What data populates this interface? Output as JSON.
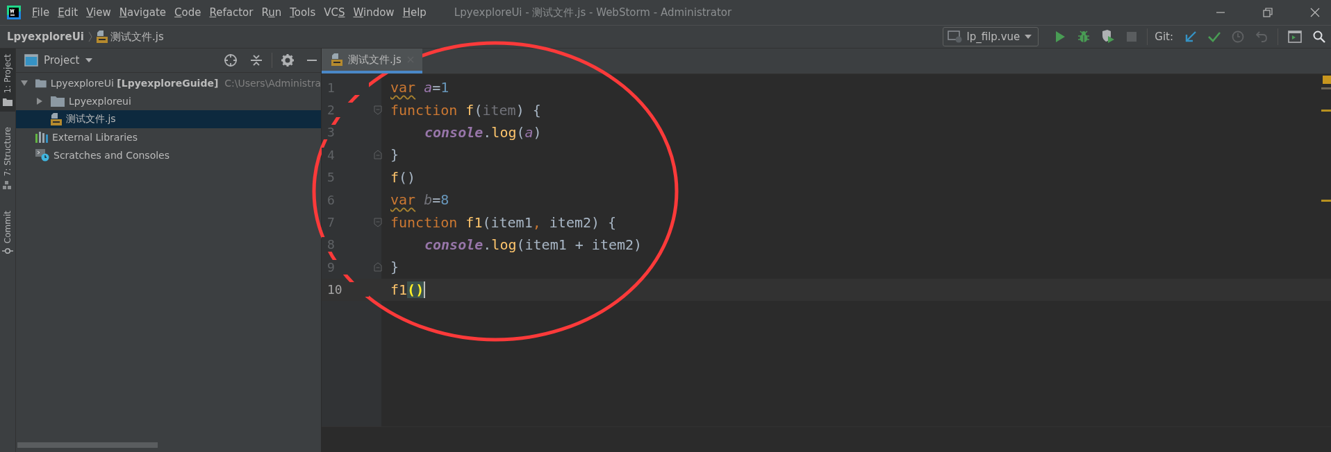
{
  "window": {
    "title": "LpyexploreUi - 测试文件.js - WebStorm - Administrator"
  },
  "menu": [
    {
      "key": "F",
      "after": "ile"
    },
    {
      "key": "E",
      "after": "dit"
    },
    {
      "key": "V",
      "after": "iew"
    },
    {
      "key": "N",
      "after": "avigate"
    },
    {
      "key": "C",
      "after": "ode"
    },
    {
      "key": "R",
      "after": "efactor"
    },
    {
      "before": "R",
      "key": "u",
      "after": "n"
    },
    {
      "key": "T",
      "after": "ools"
    },
    {
      "before": "VC",
      "key": "S"
    },
    {
      "key": "W",
      "after": "indow"
    },
    {
      "key": "H",
      "after": "elp"
    }
  ],
  "breadcrumb": {
    "project": "LpyexploreUi",
    "file": "测试文件.js"
  },
  "toolbar": {
    "run_config": "lp_filp.vue",
    "vcs_label": "Git:"
  },
  "side_tabs": [
    {
      "label": "1: Project",
      "kind": "project",
      "selected": true
    },
    {
      "label": "7: Structure",
      "kind": "structure",
      "selected": false
    },
    {
      "label": "Commit",
      "kind": "commit",
      "selected": false
    }
  ],
  "project_panel": {
    "title": "Project",
    "tree": [
      {
        "label": "LpyexploreUi",
        "module": "[LpyexploreGuide]",
        "path": "C:\\Users\\Administra",
        "kind": "project",
        "expanded": true,
        "selected": false,
        "children": [
          {
            "label": "Lpyexploreui",
            "kind": "folder",
            "expanded": false,
            "selected": false
          },
          {
            "label": "测试文件.js",
            "kind": "js-file",
            "selected": true
          }
        ]
      },
      {
        "label": "External Libraries",
        "kind": "libraries",
        "selected": false
      },
      {
        "label": "Scratches and Consoles",
        "kind": "scratches",
        "selected": false
      }
    ]
  },
  "editor": {
    "tabs": [
      {
        "label": "测试文件.js",
        "selected": true
      }
    ],
    "lines": [
      {
        "number": "1",
        "current": false,
        "indented": false,
        "tokens": [
          {
            "text": "var",
            "kind": "keyword-warn"
          },
          {
            "text": " a",
            "kind": "global"
          },
          {
            "text": "=",
            "kind": "plain"
          },
          {
            "text": "1",
            "kind": "number"
          }
        ]
      },
      {
        "number": "2",
        "current": false,
        "indented": false,
        "kind": "block-start",
        "tokens": [
          {
            "text": "function",
            "kind": "keyword"
          },
          {
            "text": " f",
            "kind": "function"
          },
          {
            "text": "(",
            "kind": "plain"
          },
          {
            "text": "item",
            "kind": "unused"
          },
          {
            "text": ") {",
            "kind": "plain"
          }
        ]
      },
      {
        "number": "3",
        "current": false,
        "indented": true,
        "tokens": [
          {
            "text": "console",
            "kind": "object"
          },
          {
            "text": ".",
            "kind": "plain"
          },
          {
            "text": "log",
            "kind": "function"
          },
          {
            "text": "(",
            "kind": "plain"
          },
          {
            "text": "a",
            "kind": "global"
          },
          {
            "text": ")",
            "kind": "plain"
          }
        ]
      },
      {
        "number": "4",
        "current": false,
        "indented": false,
        "kind": "block-end",
        "tokens": [
          {
            "text": "}",
            "kind": "plain"
          }
        ]
      },
      {
        "number": "5",
        "current": false,
        "indented": false,
        "tokens": [
          {
            "text": "f",
            "kind": "function"
          },
          {
            "text": "()",
            "kind": "plain"
          }
        ]
      },
      {
        "number": "6",
        "current": false,
        "indented": false,
        "tokens": [
          {
            "text": "var",
            "kind": "keyword-warn"
          },
          {
            "text": " b",
            "kind": "unused-global"
          },
          {
            "text": "=",
            "kind": "plain"
          },
          {
            "text": "8",
            "kind": "number"
          }
        ]
      },
      {
        "number": "7",
        "current": false,
        "indented": false,
        "kind": "block-start",
        "tokens": [
          {
            "text": "function",
            "kind": "keyword"
          },
          {
            "text": " f1",
            "kind": "function"
          },
          {
            "text": "(",
            "kind": "plain"
          },
          {
            "text": "item1",
            "kind": "param"
          },
          {
            "text": ", ",
            "kind": "keyword"
          },
          {
            "text": "item2",
            "kind": "param"
          },
          {
            "text": ") {",
            "kind": "plain"
          }
        ]
      },
      {
        "number": "8",
        "current": false,
        "indented": true,
        "tokens": [
          {
            "text": "console",
            "kind": "object"
          },
          {
            "text": ".",
            "kind": "plain"
          },
          {
            "text": "log",
            "kind": "function"
          },
          {
            "text": "(",
            "kind": "plain"
          },
          {
            "text": "item1",
            "kind": "param"
          },
          {
            "text": " + ",
            "kind": "plain"
          },
          {
            "text": "item2",
            "kind": "param"
          },
          {
            "text": ")",
            "kind": "plain"
          }
        ]
      },
      {
        "number": "9",
        "current": false,
        "indented": false,
        "kind": "block-end",
        "tokens": [
          {
            "text": "}",
            "kind": "plain"
          }
        ]
      },
      {
        "number": "10",
        "current": true,
        "indented": false,
        "tokens": [
          {
            "text": "f1",
            "kind": "function"
          },
          {
            "text": "()",
            "kind": "match"
          }
        ]
      }
    ]
  },
  "annotations": [
    {
      "kind": "ellipse"
    }
  ]
}
